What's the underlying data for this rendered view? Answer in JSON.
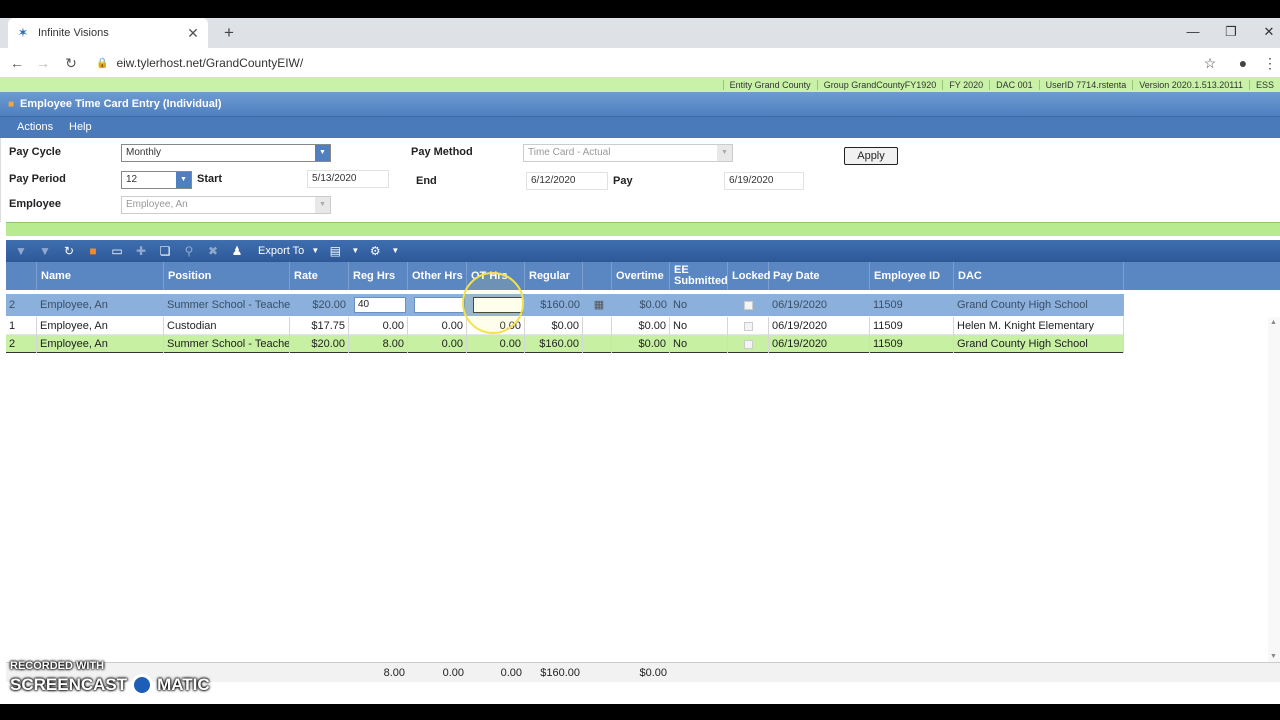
{
  "browser": {
    "tab_title": "Infinite Visions",
    "url": "eiw.tylerhost.net/GrandCountyEIW/"
  },
  "infobar": {
    "entity": "Entity Grand County",
    "group": "Group GrandCountyFY1920",
    "fy": "FY 2020",
    "dac": "DAC 001",
    "userid": "UserID 7714.rstenta",
    "version": "Version 2020.1.513.20111",
    "extra": "ESS"
  },
  "window": {
    "title": "Employee Time Card Entry (Individual)"
  },
  "menu": {
    "actions": "Actions",
    "help": "Help"
  },
  "form": {
    "pay_cycle_label": "Pay Cycle",
    "pay_cycle_value": "Monthly",
    "pay_period_label": "Pay Period",
    "pay_period_value": "12",
    "start_label": "Start",
    "start_value": "5/13/2020",
    "employee_label": "Employee",
    "employee_value": "Employee, An",
    "pay_method_label": "Pay Method",
    "pay_method_value": "Time Card - Actual",
    "end_label": "End",
    "end_value": "6/12/2020",
    "pay_label": "Pay",
    "pay_value": "6/19/2020",
    "apply_label": "Apply"
  },
  "toolbar": {
    "export_label": "Export To"
  },
  "columns": {
    "name": "Name",
    "position": "Position",
    "rate": "Rate",
    "reg_hrs": "Reg Hrs",
    "other_hrs": "Other Hrs",
    "ot_hrs": "OT Hrs",
    "regular": "Regular",
    "overtime": "Overtime",
    "ee_submitted": "EE Submitted",
    "locked": "Locked",
    "pay_date": "Pay Date",
    "employee_id": "Employee ID",
    "dac": "DAC"
  },
  "edit_row": {
    "num": "2",
    "name": "Employee, An",
    "position": "Summer School - Teacher",
    "rate": "$20.00",
    "reg_hrs": "40",
    "other_hrs": "",
    "ot_hrs": "",
    "regular": "$160.00",
    "overtime": "$0.00",
    "ee_submitted": "No",
    "pay_date": "06/19/2020",
    "employee_id": "11509",
    "dac": "Grand County High School"
  },
  "rows": [
    {
      "num": "1",
      "name": "Employee, An",
      "position": "Custodian",
      "rate": "$17.75",
      "reg_hrs": "0.00",
      "other_hrs": "0.00",
      "ot_hrs": "0.00",
      "regular": "$0.00",
      "overtime": "$0.00",
      "ee_submitted": "No",
      "pay_date": "06/19/2020",
      "employee_id": "11509",
      "dac": "Helen M. Knight Elementary"
    },
    {
      "num": "2",
      "name": "Employee, An",
      "position": "Summer School - Teacher",
      "rate": "$20.00",
      "reg_hrs": "8.00",
      "other_hrs": "0.00",
      "ot_hrs": "0.00",
      "regular": "$160.00",
      "overtime": "$0.00",
      "ee_submitted": "No",
      "pay_date": "06/19/2020",
      "employee_id": "11509",
      "dac": "Grand County High School"
    }
  ],
  "totals": {
    "reg_hrs": "8.00",
    "other_hrs": "0.00",
    "ot_hrs": "0.00",
    "regular": "$160.00",
    "overtime": "$0.00"
  },
  "watermark": {
    "line1": "RECORDED WITH",
    "line2a": "SCREENCAST",
    "line2b": "MATIC"
  }
}
